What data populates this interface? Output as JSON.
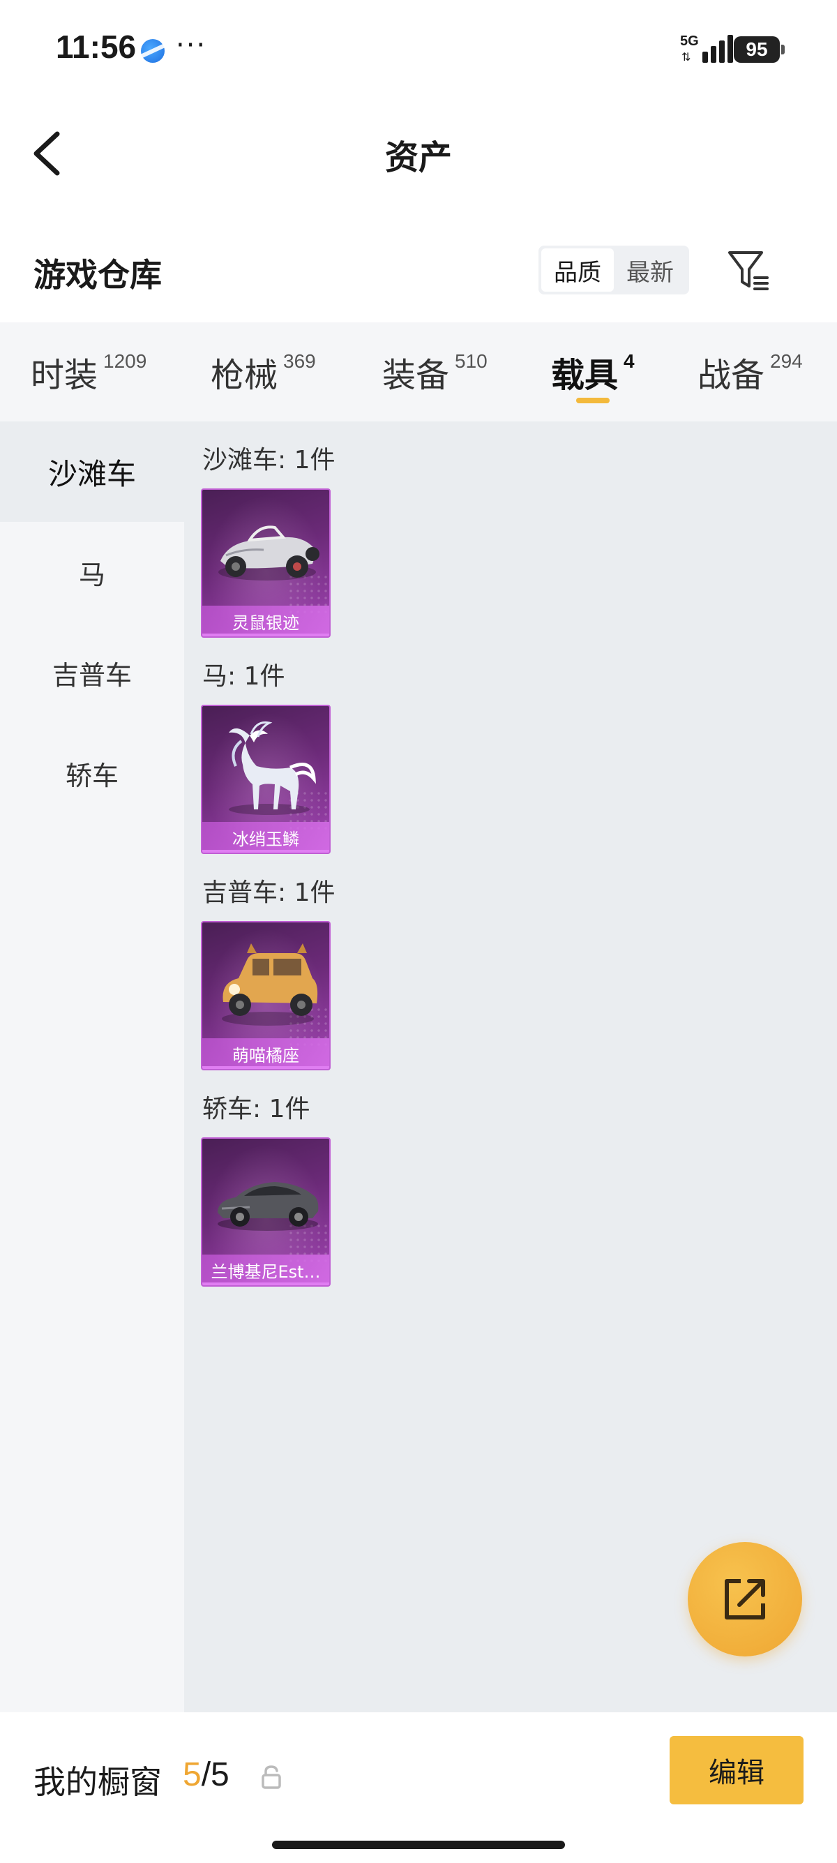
{
  "status_bar": {
    "time": "11:56",
    "dots": "···",
    "network": "5G",
    "battery": "95"
  },
  "header": {
    "title": "资产"
  },
  "section": {
    "title": "游戏仓库",
    "sort_options": [
      "品质",
      "最新"
    ],
    "sort_active": "品质"
  },
  "tabs": [
    {
      "label": "时装",
      "count": "1209"
    },
    {
      "label": "枪械",
      "count": "369"
    },
    {
      "label": "装备",
      "count": "510"
    },
    {
      "label": "载具",
      "count": "4"
    },
    {
      "label": "战备",
      "count": "294"
    }
  ],
  "active_tab": "载具",
  "sidebar": {
    "items": [
      {
        "label": "沙滩车"
      },
      {
        "label": "马"
      },
      {
        "label": "吉普车"
      },
      {
        "label": "轿车"
      }
    ],
    "active": "沙滩车"
  },
  "groups": [
    {
      "title": "沙滩车: 1件",
      "items": [
        {
          "name": "灵鼠银迹",
          "icon": "buggy-icon"
        }
      ]
    },
    {
      "title": "马: 1件",
      "items": [
        {
          "name": "冰绡玉鳞",
          "icon": "ice-horse-icon"
        }
      ]
    },
    {
      "title": "吉普车: 1件",
      "items": [
        {
          "name": "萌喵橘座",
          "icon": "cat-jeep-icon"
        }
      ]
    },
    {
      "title": "轿车: 1件",
      "items": [
        {
          "name": "兰博基尼Est…",
          "icon": "sedan-icon"
        }
      ]
    }
  ],
  "bottom_bar": {
    "label": "我的橱窗",
    "current": "5",
    "total": "/5",
    "edit_label": "编辑"
  },
  "colors": {
    "accent": "#f5bd3f",
    "card_purple": "#8e3b9e",
    "content_bg": "#eaedf0"
  }
}
